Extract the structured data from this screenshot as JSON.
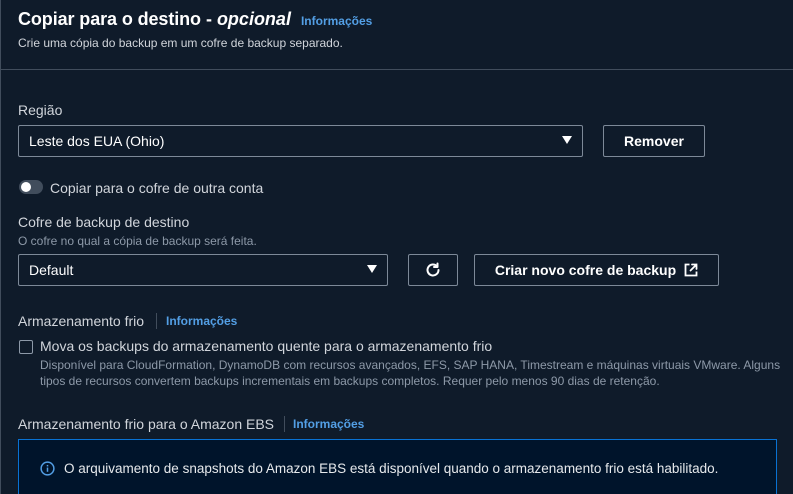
{
  "header": {
    "title": "Copiar para o destino",
    "title_dash": "-",
    "title_optional": "opcional",
    "info_link": "Informações",
    "description": "Crie uma cópia do backup em um cofre de backup separado."
  },
  "region": {
    "label": "Região",
    "selected": "Leste dos EUA (Ohio)",
    "remove_button": "Remover"
  },
  "cross_account": {
    "toggle_label": "Copiar para o cofre de outra conta",
    "enabled": false
  },
  "dest_vault": {
    "label": "Cofre de backup de destino",
    "sublabel": "O cofre no qual a cópia de backup será feita.",
    "selected": "Default",
    "create_button": "Criar novo cofre de backup"
  },
  "cold_storage": {
    "label": "Armazenamento frio",
    "info_link": "Informações",
    "checkbox_label": "Mova os backups do armazenamento quente para o armazenamento frio",
    "checked": false,
    "help_line1": "Disponível para CloudFormation, DynamoDB com recursos avançados, EFS, SAP HANA, Timestream e máquinas virtuais VMware. Alguns",
    "help_line2": "tipos de recursos convertem backups incrementais em backups completos. Requer pelo menos 90 dias de retenção."
  },
  "ebs_cold": {
    "label": "Armazenamento frio para o Amazon EBS",
    "info_link": "Informações",
    "alert_text": "O arquivamento de snapshots do Amazon EBS está disponível quando o armazenamento frio está habilitado."
  },
  "colors": {
    "background": "#0f1b2a",
    "link": "#539fe5",
    "alert_border": "#0972d3"
  }
}
